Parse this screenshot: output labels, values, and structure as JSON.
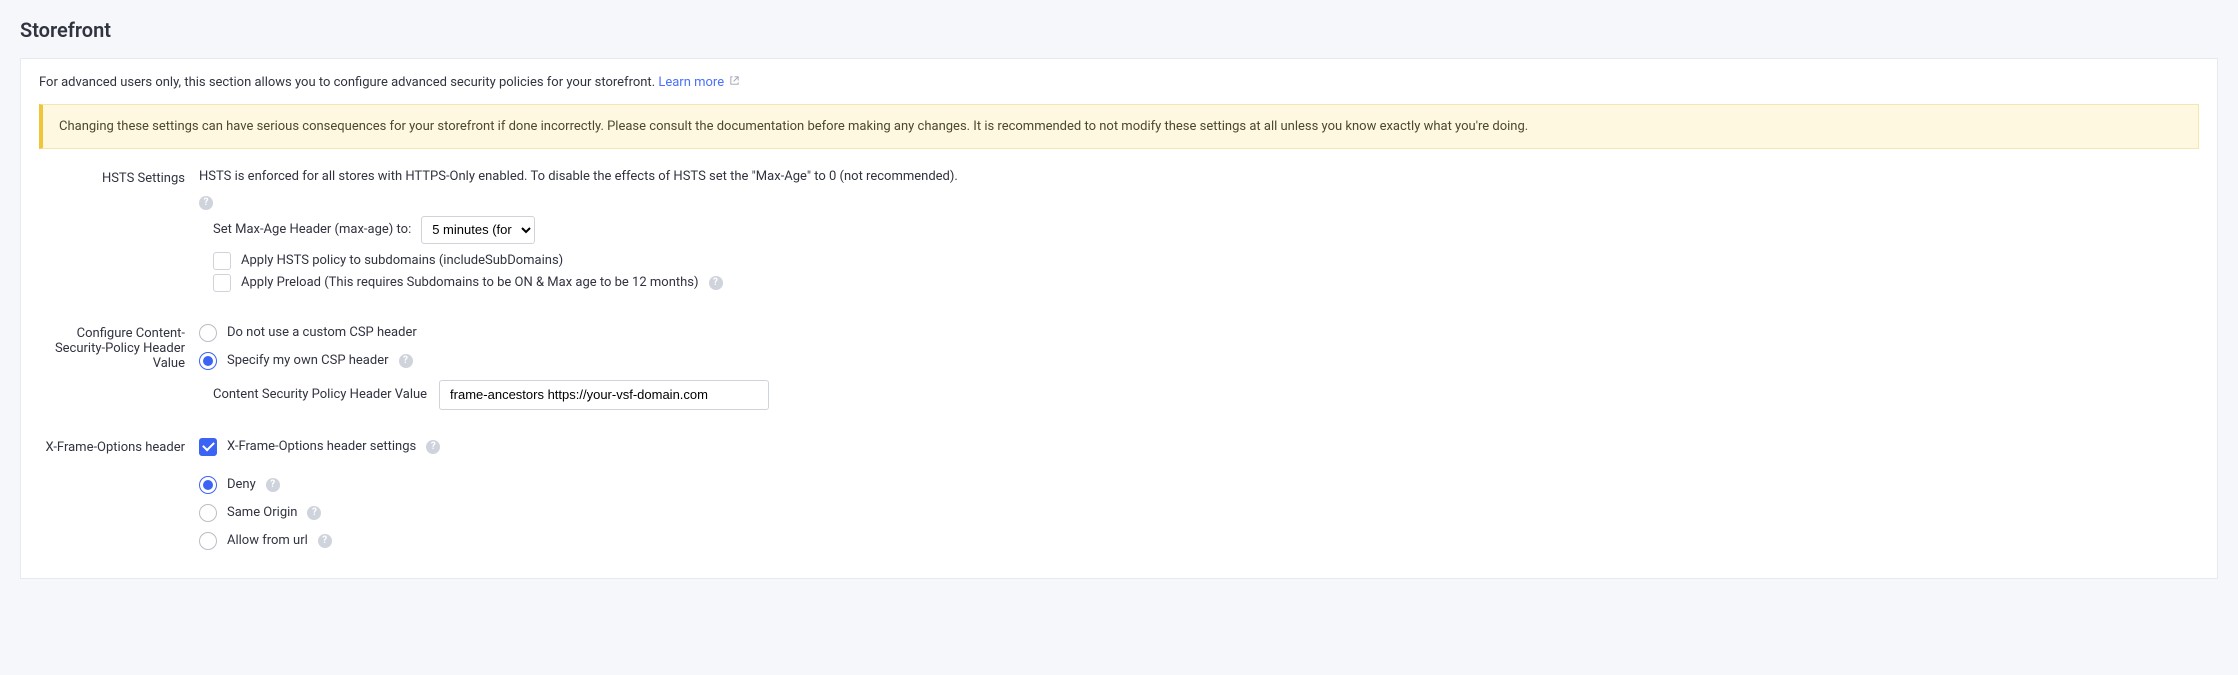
{
  "page_title": "Storefront",
  "intro_text": "For advanced users only, this section allows you to configure advanced security policies for your storefront. ",
  "learn_more_label": "Learn more",
  "alert_text": "Changing these settings can have serious consequences for your storefront if done incorrectly. Please consult the documentation before making any changes. It is recommended to not modify these settings at all unless you know exactly what you're doing.",
  "hsts": {
    "label": "HSTS Settings",
    "description": "HSTS is enforced for all stores with HTTPS-Only enabled. To disable the effects of HSTS set the \"Max-Age\" to 0 (not recommended).",
    "max_age_label": "Set Max-Age Header (max-age) to:",
    "max_age_value": "5 minutes (for",
    "apply_subdomains_label": "Apply HSTS policy to subdomains (includeSubDomains)",
    "apply_preload_label": "Apply Preload (This requires Subdomains to be ON & Max age to be 12 months)"
  },
  "csp": {
    "label": "Configure Content-Security-Policy Header Value",
    "option_none": "Do not use a custom CSP header",
    "option_specify": "Specify my own CSP header",
    "value_label": "Content Security Policy Header Value",
    "value_input": "frame-ancestors https://your-vsf-domain.com"
  },
  "xframe": {
    "label": "X-Frame-Options header",
    "checkbox_label": "X-Frame-Options header settings",
    "option_deny": "Deny",
    "option_same_origin": "Same Origin",
    "option_allow_from_url": "Allow from url"
  }
}
